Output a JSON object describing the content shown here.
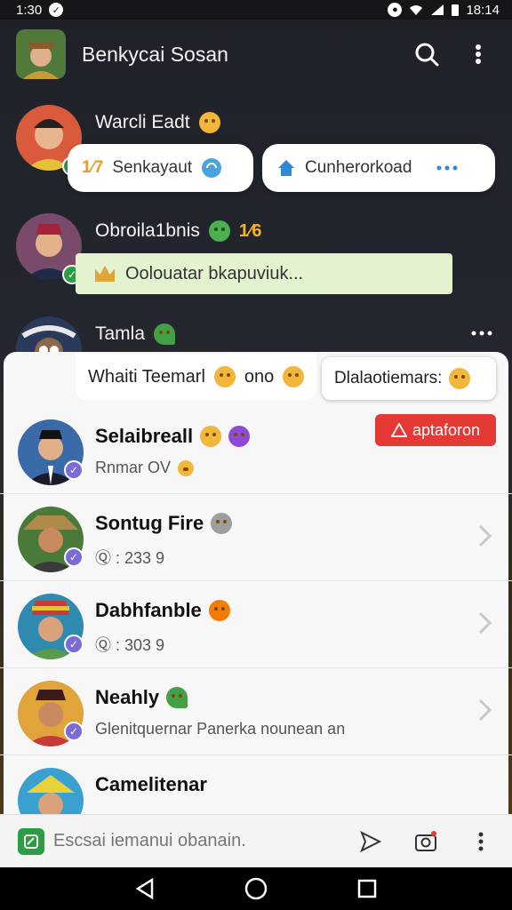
{
  "status_bar": {
    "left_time": "1:30",
    "right_time": "18:14"
  },
  "header": {
    "title": "Benkycai Sosan"
  },
  "dark_chats": [
    {
      "name": "Warcli Eadt",
      "pill_left": "Senkayaut",
      "pill_left_prefix": "1⁄7",
      "pill_right": "Cunherorkoad"
    },
    {
      "name": "Obroila1bnis",
      "count": "1⁄6",
      "message": "Oolouatar bkapuviuk..."
    },
    {
      "name": "Tamla"
    }
  ],
  "tabs": {
    "left_label": "Whaiti Teemarl",
    "left_suffix": "ono",
    "right_label": "Dlalaotiemars:"
  },
  "chats": [
    {
      "name": "Selaibreall",
      "sub": "Rnmar OV",
      "action": "aptaforon"
    },
    {
      "name": "Sontug Fire",
      "sub": "Ⓠ : 233 9"
    },
    {
      "name": "Dabhfanble",
      "sub": "Ⓠ : 303 9"
    },
    {
      "name": "Neahly",
      "sub": "Glenitquernar Panerka nounean an"
    },
    {
      "name": "Camelitenar",
      "sub": ""
    }
  ],
  "compose": {
    "placeholder": "Escsai iemanui obanain."
  },
  "colors": {
    "accent_green": "#2e9b45",
    "accent_red": "#e53935",
    "badge_purple": "#7c6ad6"
  }
}
